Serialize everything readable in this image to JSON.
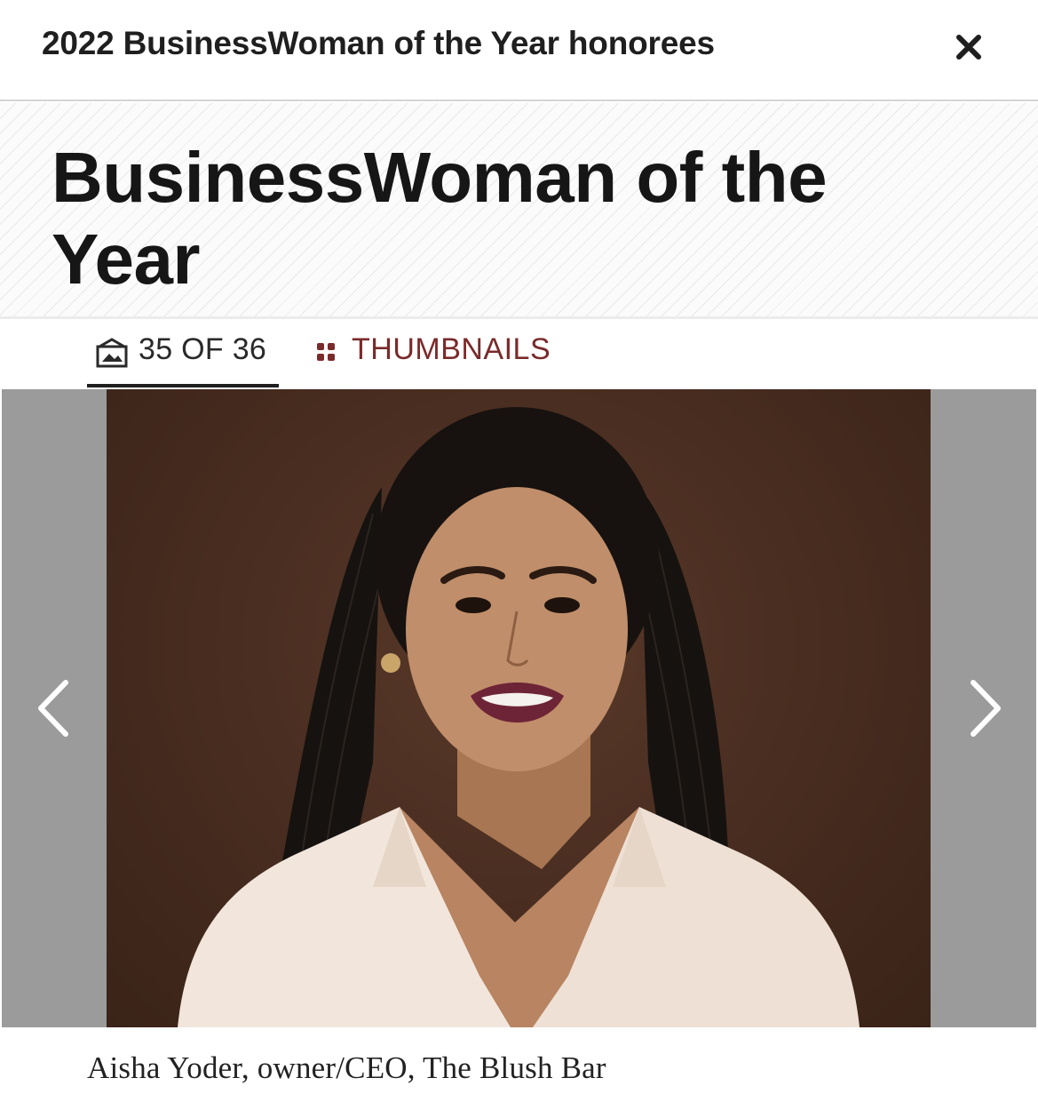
{
  "header": {
    "title": "2022 BusinessWoman of the Year honorees",
    "close_icon": "close-icon"
  },
  "hero": {
    "title": "BusinessWoman of the Year"
  },
  "tabs": {
    "counter_icon": "gallery-icon",
    "counter_label": "35 OF 36",
    "thumbnails_icon": "grid-icon",
    "thumbnails_label": "THUMBNAILS",
    "thumbnails_color": "#7a2a2a"
  },
  "gallery": {
    "prev_icon": "chevron-left-icon",
    "next_icon": "chevron-right-icon",
    "photo_alt": "Portrait photo",
    "caption": "Aisha Yoder, owner/CEO, The Blush Bar"
  }
}
